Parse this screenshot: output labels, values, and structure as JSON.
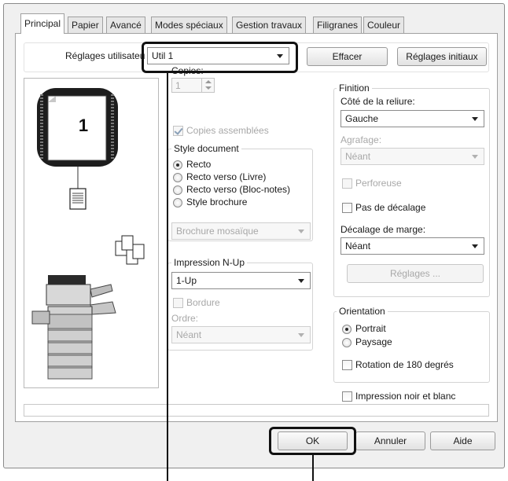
{
  "tabs": [
    "Principal",
    "Papier",
    "Avancé",
    "Modes spéciaux",
    "Gestion travaux",
    "Filigranes",
    "Couleur"
  ],
  "user_settings": {
    "label": "Réglages utilisateu",
    "value": "Util 1",
    "clear": "Effacer",
    "defaults": "Réglages initiaux"
  },
  "preview": {
    "page_number": "1"
  },
  "copies": {
    "label": "Copies:",
    "value": "1",
    "collate": "Copies assemblées"
  },
  "document_style": {
    "title": "Style document",
    "options": [
      "Recto",
      "Recto verso (Livre)",
      "Recto verso (Bloc-notes)",
      "Style brochure"
    ],
    "selected": "Recto",
    "brochure_select": "Brochure mosaïque"
  },
  "nup": {
    "title": "Impression N-Up",
    "value": "1-Up",
    "border": "Bordure",
    "order_label": "Ordre:",
    "order_value": "Néant"
  },
  "finishing": {
    "title": "Finition",
    "binding_label": "Côté de la reliure:",
    "binding_value": "Gauche",
    "staple_label": "Agrafage:",
    "staple_value": "Néant",
    "punch": "Perforeuse",
    "no_offset": "Pas de décalage",
    "margin_label": "Décalage de marge:",
    "margin_value": "Néant",
    "settings_button": "Réglages ..."
  },
  "orientation": {
    "title": "Orientation",
    "portrait": "Portrait",
    "landscape": "Paysage",
    "rotate": "Rotation de 180 degrés"
  },
  "bw_print": "Impression noir et blanc",
  "footer": {
    "ok": "OK",
    "cancel": "Annuler",
    "help": "Aide"
  },
  "colors": {
    "callout": "#111111",
    "disabled_text": "#a8a8a8",
    "panel_bg": "#ffffff",
    "dialog_bg": "#f0f0f0"
  }
}
